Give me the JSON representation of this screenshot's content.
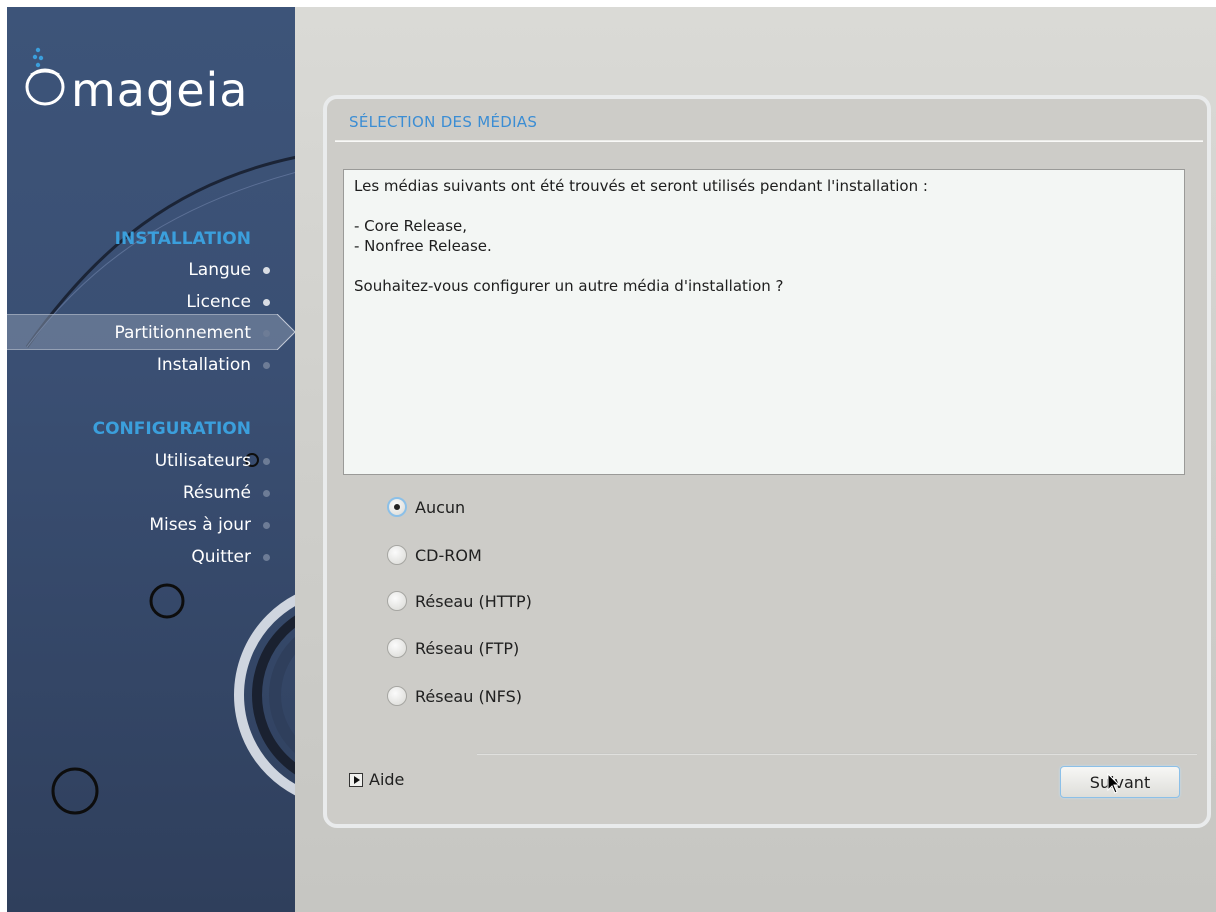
{
  "brand": {
    "logo_text": "mageia"
  },
  "sidebar": {
    "sections": [
      {
        "title": "INSTALLATION",
        "steps": [
          {
            "label": "Langue",
            "state": "done"
          },
          {
            "label": "Licence",
            "state": "done"
          },
          {
            "label": "Partitionnement",
            "state": "current"
          },
          {
            "label": "Installation",
            "state": "pending"
          }
        ]
      },
      {
        "title": "CONFIGURATION",
        "steps": [
          {
            "label": "Utilisateurs",
            "state": "pending"
          },
          {
            "label": "Résumé",
            "state": "pending"
          },
          {
            "label": "Mises à jour",
            "state": "pending"
          },
          {
            "label": "Quitter",
            "state": "pending"
          }
        ]
      }
    ]
  },
  "dialog": {
    "title": "SÉLECTION DES MÉDIAS",
    "message": {
      "intro": "Les médias suivants ont été trouvés et seront utilisés pendant l'installation :",
      "media": [
        "- Core Release,",
        "- Nonfree Release."
      ],
      "question": "Souhaitez-vous configurer un autre média d'installation ?"
    },
    "options": [
      {
        "label": "Aucun",
        "selected": true
      },
      {
        "label": "CD-ROM",
        "selected": false
      },
      {
        "label": "Réseau (HTTP)",
        "selected": false
      },
      {
        "label": "Réseau (FTP)",
        "selected": false
      },
      {
        "label": "Réseau (NFS)",
        "selected": false
      }
    ],
    "help_label": "Aide",
    "next_label": "Suivant"
  },
  "colors": {
    "accent": "#3b9fdc",
    "sidebar_bg": "#3a4f73",
    "dialog_bg": "#cdccc8"
  }
}
